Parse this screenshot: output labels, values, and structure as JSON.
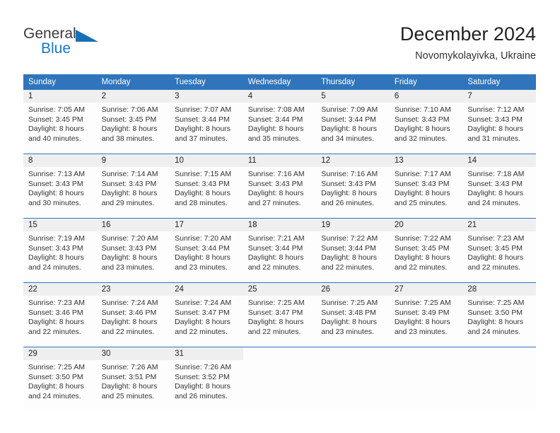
{
  "logo": {
    "word_top": "General",
    "word_bottom": "Blue",
    "triangle_color": "#1b6fb4",
    "text_color": "#3b3b3b",
    "blue_text_color": "#1878c4"
  },
  "header": {
    "title": "December 2024",
    "location": "Novomykolayivka, Ukraine"
  },
  "theme": {
    "header_blue": "#3075bb",
    "daynum_bg": "#efefef",
    "cell_bg": "#fdfdfd",
    "text": "#333333"
  },
  "weekday_headers": [
    "Sunday",
    "Monday",
    "Tuesday",
    "Wednesday",
    "Thursday",
    "Friday",
    "Saturday"
  ],
  "weeks": [
    {
      "days": [
        {
          "num": "1",
          "sunrise": "Sunrise: 7:05 AM",
          "sunset": "Sunset: 3:45 PM",
          "daylight1": "Daylight: 8 hours",
          "daylight2": "and 40 minutes."
        },
        {
          "num": "2",
          "sunrise": "Sunrise: 7:06 AM",
          "sunset": "Sunset: 3:45 PM",
          "daylight1": "Daylight: 8 hours",
          "daylight2": "and 38 minutes."
        },
        {
          "num": "3",
          "sunrise": "Sunrise: 7:07 AM",
          "sunset": "Sunset: 3:44 PM",
          "daylight1": "Daylight: 8 hours",
          "daylight2": "and 37 minutes."
        },
        {
          "num": "4",
          "sunrise": "Sunrise: 7:08 AM",
          "sunset": "Sunset: 3:44 PM",
          "daylight1": "Daylight: 8 hours",
          "daylight2": "and 35 minutes."
        },
        {
          "num": "5",
          "sunrise": "Sunrise: 7:09 AM",
          "sunset": "Sunset: 3:44 PM",
          "daylight1": "Daylight: 8 hours",
          "daylight2": "and 34 minutes."
        },
        {
          "num": "6",
          "sunrise": "Sunrise: 7:10 AM",
          "sunset": "Sunset: 3:43 PM",
          "daylight1": "Daylight: 8 hours",
          "daylight2": "and 32 minutes."
        },
        {
          "num": "7",
          "sunrise": "Sunrise: 7:12 AM",
          "sunset": "Sunset: 3:43 PM",
          "daylight1": "Daylight: 8 hours",
          "daylight2": "and 31 minutes."
        }
      ]
    },
    {
      "days": [
        {
          "num": "8",
          "sunrise": "Sunrise: 7:13 AM",
          "sunset": "Sunset: 3:43 PM",
          "daylight1": "Daylight: 8 hours",
          "daylight2": "and 30 minutes."
        },
        {
          "num": "9",
          "sunrise": "Sunrise: 7:14 AM",
          "sunset": "Sunset: 3:43 PM",
          "daylight1": "Daylight: 8 hours",
          "daylight2": "and 29 minutes."
        },
        {
          "num": "10",
          "sunrise": "Sunrise: 7:15 AM",
          "sunset": "Sunset: 3:43 PM",
          "daylight1": "Daylight: 8 hours",
          "daylight2": "and 28 minutes."
        },
        {
          "num": "11",
          "sunrise": "Sunrise: 7:16 AM",
          "sunset": "Sunset: 3:43 PM",
          "daylight1": "Daylight: 8 hours",
          "daylight2": "and 27 minutes."
        },
        {
          "num": "12",
          "sunrise": "Sunrise: 7:16 AM",
          "sunset": "Sunset: 3:43 PM",
          "daylight1": "Daylight: 8 hours",
          "daylight2": "and 26 minutes."
        },
        {
          "num": "13",
          "sunrise": "Sunrise: 7:17 AM",
          "sunset": "Sunset: 3:43 PM",
          "daylight1": "Daylight: 8 hours",
          "daylight2": "and 25 minutes."
        },
        {
          "num": "14",
          "sunrise": "Sunrise: 7:18 AM",
          "sunset": "Sunset: 3:43 PM",
          "daylight1": "Daylight: 8 hours",
          "daylight2": "and 24 minutes."
        }
      ]
    },
    {
      "days": [
        {
          "num": "15",
          "sunrise": "Sunrise: 7:19 AM",
          "sunset": "Sunset: 3:43 PM",
          "daylight1": "Daylight: 8 hours",
          "daylight2": "and 24 minutes."
        },
        {
          "num": "16",
          "sunrise": "Sunrise: 7:20 AM",
          "sunset": "Sunset: 3:43 PM",
          "daylight1": "Daylight: 8 hours",
          "daylight2": "and 23 minutes."
        },
        {
          "num": "17",
          "sunrise": "Sunrise: 7:20 AM",
          "sunset": "Sunset: 3:44 PM",
          "daylight1": "Daylight: 8 hours",
          "daylight2": "and 23 minutes."
        },
        {
          "num": "18",
          "sunrise": "Sunrise: 7:21 AM",
          "sunset": "Sunset: 3:44 PM",
          "daylight1": "Daylight: 8 hours",
          "daylight2": "and 22 minutes."
        },
        {
          "num": "19",
          "sunrise": "Sunrise: 7:22 AM",
          "sunset": "Sunset: 3:44 PM",
          "daylight1": "Daylight: 8 hours",
          "daylight2": "and 22 minutes."
        },
        {
          "num": "20",
          "sunrise": "Sunrise: 7:22 AM",
          "sunset": "Sunset: 3:45 PM",
          "daylight1": "Daylight: 8 hours",
          "daylight2": "and 22 minutes."
        },
        {
          "num": "21",
          "sunrise": "Sunrise: 7:23 AM",
          "sunset": "Sunset: 3:45 PM",
          "daylight1": "Daylight: 8 hours",
          "daylight2": "and 22 minutes."
        }
      ]
    },
    {
      "days": [
        {
          "num": "22",
          "sunrise": "Sunrise: 7:23 AM",
          "sunset": "Sunset: 3:46 PM",
          "daylight1": "Daylight: 8 hours",
          "daylight2": "and 22 minutes."
        },
        {
          "num": "23",
          "sunrise": "Sunrise: 7:24 AM",
          "sunset": "Sunset: 3:46 PM",
          "daylight1": "Daylight: 8 hours",
          "daylight2": "and 22 minutes."
        },
        {
          "num": "24",
          "sunrise": "Sunrise: 7:24 AM",
          "sunset": "Sunset: 3:47 PM",
          "daylight1": "Daylight: 8 hours",
          "daylight2": "and 22 minutes."
        },
        {
          "num": "25",
          "sunrise": "Sunrise: 7:25 AM",
          "sunset": "Sunset: 3:47 PM",
          "daylight1": "Daylight: 8 hours",
          "daylight2": "and 22 minutes."
        },
        {
          "num": "26",
          "sunrise": "Sunrise: 7:25 AM",
          "sunset": "Sunset: 3:48 PM",
          "daylight1": "Daylight: 8 hours",
          "daylight2": "and 23 minutes."
        },
        {
          "num": "27",
          "sunrise": "Sunrise: 7:25 AM",
          "sunset": "Sunset: 3:49 PM",
          "daylight1": "Daylight: 8 hours",
          "daylight2": "and 23 minutes."
        },
        {
          "num": "28",
          "sunrise": "Sunrise: 7:25 AM",
          "sunset": "Sunset: 3:50 PM",
          "daylight1": "Daylight: 8 hours",
          "daylight2": "and 24 minutes."
        }
      ]
    },
    {
      "days": [
        {
          "num": "29",
          "sunrise": "Sunrise: 7:25 AM",
          "sunset": "Sunset: 3:50 PM",
          "daylight1": "Daylight: 8 hours",
          "daylight2": "and 24 minutes."
        },
        {
          "num": "30",
          "sunrise": "Sunrise: 7:26 AM",
          "sunset": "Sunset: 3:51 PM",
          "daylight1": "Daylight: 8 hours",
          "daylight2": "and 25 minutes."
        },
        {
          "num": "31",
          "sunrise": "Sunrise: 7:26 AM",
          "sunset": "Sunset: 3:52 PM",
          "daylight1": "Daylight: 8 hours",
          "daylight2": "and 26 minutes."
        },
        {
          "num": "",
          "sunrise": "",
          "sunset": "",
          "daylight1": "",
          "daylight2": ""
        },
        {
          "num": "",
          "sunrise": "",
          "sunset": "",
          "daylight1": "",
          "daylight2": ""
        },
        {
          "num": "",
          "sunrise": "",
          "sunset": "",
          "daylight1": "",
          "daylight2": ""
        },
        {
          "num": "",
          "sunrise": "",
          "sunset": "",
          "daylight1": "",
          "daylight2": ""
        }
      ]
    }
  ]
}
